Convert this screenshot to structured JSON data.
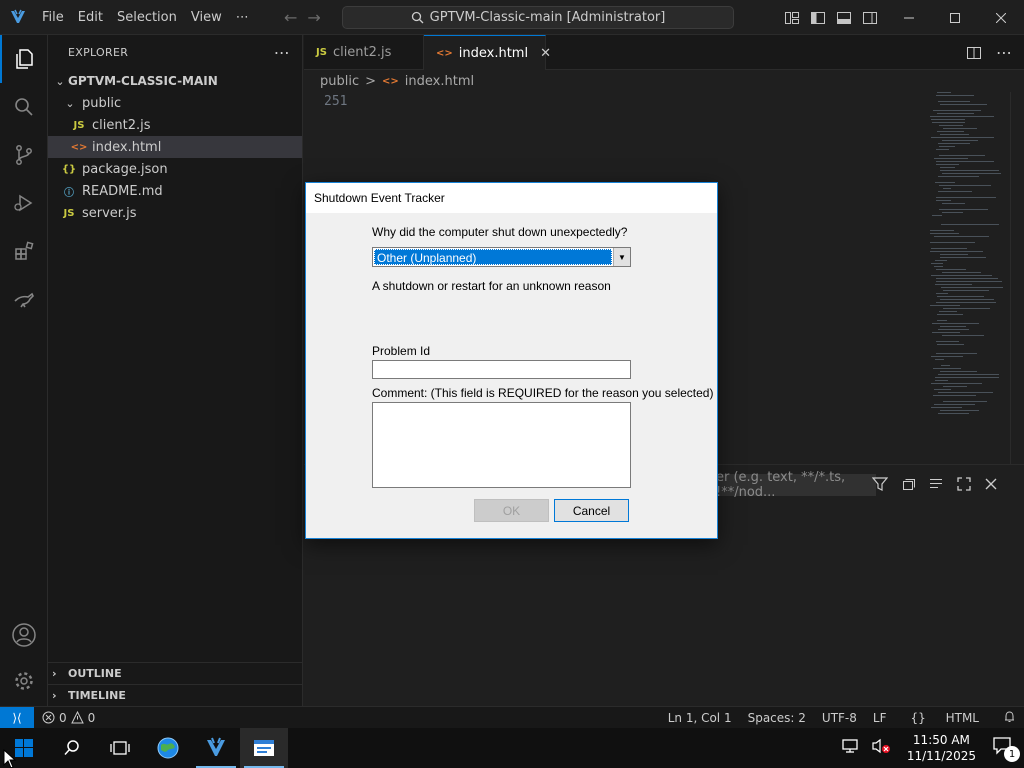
{
  "titlebar": {
    "menu": [
      "File",
      "Edit",
      "Selection",
      "View",
      "⋯"
    ],
    "search_text": "GPTVM-Classic-main [Administrator]",
    "back_arrow": "←",
    "forward_arrow": "→",
    "minimize": "—",
    "close": "✕"
  },
  "sidebar": {
    "header": "EXPLORER",
    "header_more": "⋯",
    "root": "GPTVM-CLASSIC-MAIN",
    "tree": [
      {
        "name": "public",
        "kind": "folder"
      },
      {
        "name": "client2.js",
        "kind": "js"
      },
      {
        "name": "index.html",
        "kind": "html"
      },
      {
        "name": "package.json",
        "kind": "json"
      },
      {
        "name": "README.md",
        "kind": "info"
      },
      {
        "name": "server.js",
        "kind": "js"
      }
    ],
    "outline": "OUTLINE",
    "timeline": "TIMELINE"
  },
  "tabs": [
    {
      "label": "client2.js",
      "icon": "JS",
      "active": false
    },
    {
      "label": "index.html",
      "icon": "<>",
      "active": true
    }
  ],
  "breadcrumb": {
    "folder": "public",
    "sep": ">",
    "file": "index.html"
  },
  "editor": {
    "line_number": "251"
  },
  "panel": {
    "filter_placeholder": "er (e.g. text, **/*.ts, !**/nod..."
  },
  "statusbar": {
    "errors": "0",
    "warnings": "0",
    "position": "Ln 1, Col 1",
    "spaces": "Spaces: 2",
    "encoding": "UTF-8",
    "eol": "LF",
    "language": "HTML",
    "language_prefix": "{}"
  },
  "dialog": {
    "title": "Shutdown Event Tracker",
    "question": "Why did the computer shut down unexpectedly?",
    "selected_reason": "Other (Unplanned)",
    "reason_description": "A shutdown or restart for an unknown reason",
    "problem_id_label": "Problem Id",
    "problem_id_value": "",
    "comment_label": "Comment: (This field is REQUIRED for the reason you selected)",
    "comment_value": "",
    "ok_label": "OK",
    "cancel_label": "Cancel"
  },
  "taskbar": {
    "time": "11:50 AM",
    "date": "11/11/2025",
    "notification_count": "1"
  },
  "colors": {
    "accent": "#0078d4",
    "selection": "#0078d7",
    "js_icon": "#cbcb41",
    "html_icon": "#e37933",
    "json_icon": "#cbcb41",
    "info_icon": "#519aba"
  }
}
